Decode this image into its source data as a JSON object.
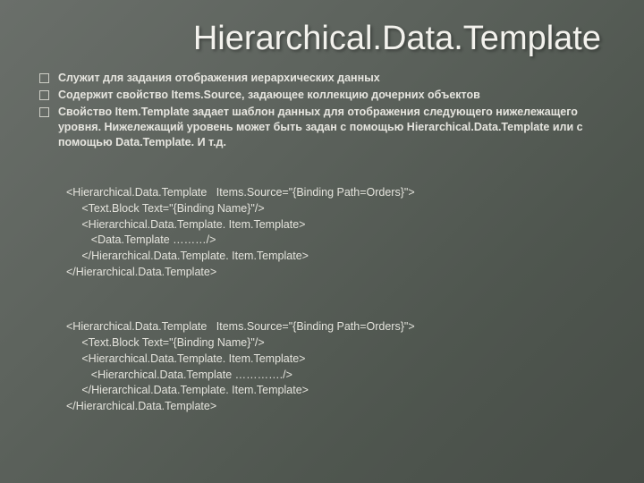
{
  "title": "Hierarchical.Data.Template",
  "bullets": [
    "Служит для задания отображения иерархических данных",
    "Содержит свойство Items.Source, задающее коллекцию дочерних объектов",
    "Свойство Item.Template задает шаблон данных для отображения следующего нижележащего уровня. Нижележащий уровень может быть задан с помощью Hierarchical.Data.Template или с помощью Data.Template. И т.д."
  ],
  "code1": [
    "<Hierarchical.Data.Template   Items.Source=\"{Binding Path=Orders}\">",
    "     <Text.Block Text=\"{Binding Name}\"/>",
    "     <Hierarchical.Data.Template. Item.Template>",
    "        <Data.Template ………/>",
    "     </Hierarchical.Data.Template. Item.Template>",
    "</Hierarchical.Data.Template>"
  ],
  "code2": [
    "<Hierarchical.Data.Template   Items.Source=\"{Binding Path=Orders}\">",
    "     <Text.Block Text=\"{Binding Name}\"/>",
    "     <Hierarchical.Data.Template. Item.Template>",
    "        <Hierarchical.Data.Template …………./>",
    "     </Hierarchical.Data.Template. Item.Template>",
    "</Hierarchical.Data.Template>"
  ]
}
